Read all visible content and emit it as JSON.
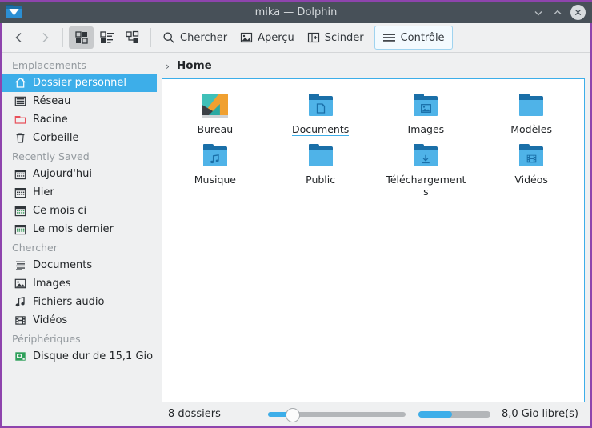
{
  "window": {
    "title": "mika — Dolphin",
    "app_icon": "folder-app-icon",
    "controls": {
      "minimize": "Minimize",
      "maximize": "Maximize",
      "close": "Close"
    }
  },
  "toolbar": {
    "back": "Back",
    "forward": "Forward",
    "view_modes": [
      {
        "name": "icons-view",
        "label": "Icons",
        "active": true
      },
      {
        "name": "compact-view",
        "label": "Compact",
        "active": false
      },
      {
        "name": "details-view",
        "label": "Details",
        "active": false
      }
    ],
    "search_label": "Chercher",
    "preview_label": "Aperçu",
    "split_label": "Scinder",
    "control_label": "Contrôle"
  },
  "sidebar": {
    "groups": [
      {
        "title": "Emplacements",
        "items": [
          {
            "label": "Dossier personnel",
            "icon": "home-icon",
            "selected": true
          },
          {
            "label": "Réseau",
            "icon": "network-icon",
            "selected": false
          },
          {
            "label": "Racine",
            "icon": "root-folder-icon",
            "selected": false
          },
          {
            "label": "Corbeille",
            "icon": "trash-icon",
            "selected": false
          }
        ]
      },
      {
        "title": "Recently Saved",
        "items": [
          {
            "label": "Aujourd'hui",
            "icon": "calendar-icon",
            "selected": false
          },
          {
            "label": "Hier",
            "icon": "calendar-icon",
            "selected": false
          },
          {
            "label": "Ce mois ci",
            "icon": "calendar-icon",
            "selected": false
          },
          {
            "label": "Le mois dernier",
            "icon": "calendar-icon",
            "selected": false
          }
        ]
      },
      {
        "title": "Chercher",
        "items": [
          {
            "label": "Documents",
            "icon": "document-icon",
            "selected": false
          },
          {
            "label": "Images",
            "icon": "image-icon",
            "selected": false
          },
          {
            "label": "Fichiers audio",
            "icon": "audio-icon",
            "selected": false
          },
          {
            "label": "Vidéos",
            "icon": "video-icon",
            "selected": false
          }
        ]
      },
      {
        "title": "Périphériques",
        "items": [
          {
            "label": "Disque dur de 15,1 Gio",
            "icon": "harddisk-icon",
            "selected": false
          }
        ]
      }
    ]
  },
  "breadcrumb": {
    "separator": "›",
    "current": "Home"
  },
  "files": [
    {
      "name": "Bureau",
      "icon": "desktop-picture-icon",
      "active": false
    },
    {
      "name": "Documents",
      "icon": "folder-documents-icon",
      "active": true
    },
    {
      "name": "Images",
      "icon": "folder-images-icon",
      "active": false
    },
    {
      "name": "Modèles",
      "icon": "folder-plain-icon",
      "active": false
    },
    {
      "name": "Musique",
      "icon": "folder-music-icon",
      "active": false
    },
    {
      "name": "Public",
      "icon": "folder-plain-icon",
      "active": false
    },
    {
      "name": "Téléchargements",
      "icon": "folder-downloads-icon",
      "active": false
    },
    {
      "name": "Vidéos",
      "icon": "folder-videos-icon",
      "active": false
    }
  ],
  "statusbar": {
    "count_text": "8 dossiers",
    "free_text": "8,0 Gio libre(s)",
    "zoom_percent": 13,
    "free_percent": 47
  },
  "colors": {
    "accent": "#3daee9",
    "titlebar": "#475058",
    "window_border": "#8e44ad",
    "panel_bg": "#eff0f1",
    "folder_light": "#4fb3e8",
    "folder_dark": "#1a6fa8"
  }
}
